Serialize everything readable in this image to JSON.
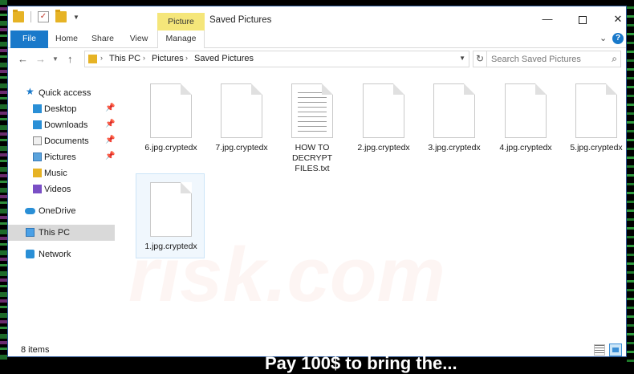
{
  "window": {
    "title": "Saved Pictures",
    "context_tab": "Picture Tools",
    "minimize": "—",
    "close": "✕"
  },
  "ribbon": {
    "tabs": [
      "File",
      "Home",
      "Share",
      "View",
      "Manage"
    ],
    "help": "?"
  },
  "address": {
    "breadcrumb": [
      "This PC",
      "Pictures",
      "Saved Pictures"
    ],
    "search_placeholder": "Search Saved Pictures"
  },
  "sidebar": {
    "items": [
      {
        "label": "Quick access",
        "icon": "star-icon",
        "pinned": false
      },
      {
        "label": "Desktop",
        "icon": "desktop-folder-icon",
        "pinned": true
      },
      {
        "label": "Downloads",
        "icon": "downloads-folder-icon",
        "pinned": true
      },
      {
        "label": "Documents",
        "icon": "documents-folder-icon",
        "pinned": true
      },
      {
        "label": "Pictures",
        "icon": "pictures-folder-icon",
        "pinned": true
      },
      {
        "label": "Music",
        "icon": "music-folder-icon",
        "pinned": false
      },
      {
        "label": "Videos",
        "icon": "videos-folder-icon",
        "pinned": false
      },
      {
        "label": "OneDrive",
        "icon": "onedrive-cloud-icon",
        "pinned": false
      },
      {
        "label": "This PC",
        "icon": "computer-icon",
        "pinned": false,
        "selected": true
      },
      {
        "label": "Network",
        "icon": "network-icon",
        "pinned": false
      }
    ]
  },
  "files": [
    {
      "name": "6.jpg.cryptedx",
      "type": "blank"
    },
    {
      "name": "7.jpg.cryptedx",
      "type": "blank"
    },
    {
      "name": "HOW TO DECRYPT FILES.txt",
      "type": "text",
      "lines": [
        "HOW TO",
        "DECRYPT",
        "FILES.txt"
      ]
    },
    {
      "name": "2.jpg.cryptedx",
      "type": "blank"
    },
    {
      "name": "3.jpg.cryptedx",
      "type": "blank"
    },
    {
      "name": "4.jpg.cryptedx",
      "type": "blank"
    },
    {
      "name": "5.jpg.cryptedx",
      "type": "blank"
    },
    {
      "name": "1.jpg.cryptedx",
      "type": "blank",
      "selected": true
    }
  ],
  "status": {
    "items_count": "8 items"
  },
  "watermark": "risk.com",
  "desktop_banner": "Pay 100$ to bring the...",
  "colors": {
    "accent": "#1979ca",
    "context_tab": "#f5e67a",
    "folder": "#e6b325"
  }
}
